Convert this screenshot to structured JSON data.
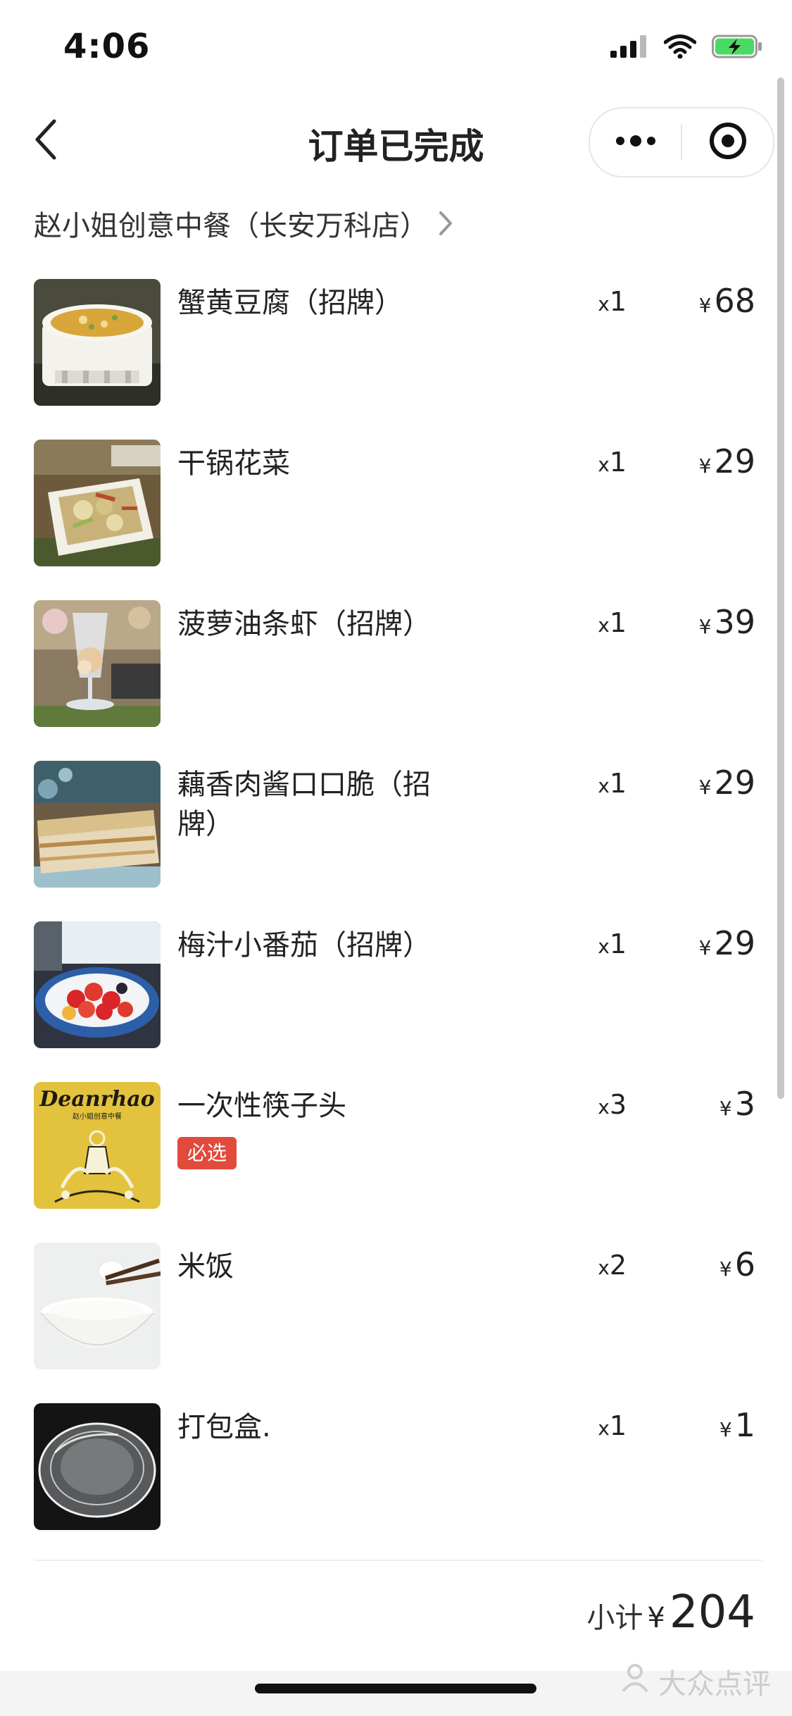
{
  "status_bar": {
    "time": "4:06",
    "icons": [
      "signal-icon",
      "wifi-icon",
      "battery-charging-icon"
    ],
    "battery_color": "#4cd964"
  },
  "header": {
    "title": "订单已完成",
    "back_icon": "chevron-left-icon",
    "capsule": [
      "more-icon",
      "close-target-icon"
    ]
  },
  "store": {
    "name": "赵小姐创意中餐（长安万科店）",
    "chevron": "chevron-right-icon"
  },
  "items": [
    {
      "name": "蟹黄豆腐（招牌）",
      "qty_prefix": "x",
      "qty": "1",
      "currency": "¥",
      "price": "68",
      "badge": ""
    },
    {
      "name": "干锅花菜",
      "qty_prefix": "x",
      "qty": "1",
      "currency": "¥",
      "price": "29",
      "badge": ""
    },
    {
      "name": "菠萝油条虾（招牌）",
      "qty_prefix": "x",
      "qty": "1",
      "currency": "¥",
      "price": "39",
      "badge": ""
    },
    {
      "name": "藕香肉酱口口脆（招牌）",
      "qty_prefix": "x",
      "qty": "1",
      "currency": "¥",
      "price": "29",
      "badge": ""
    },
    {
      "name": "梅汁小番茄（招牌）",
      "qty_prefix": "x",
      "qty": "1",
      "currency": "¥",
      "price": "29",
      "badge": ""
    },
    {
      "name": "一次性筷子头",
      "qty_prefix": "x",
      "qty": "3",
      "currency": "¥",
      "price": "3",
      "badge": "必选"
    },
    {
      "name": "米饭",
      "qty_prefix": "x",
      "qty": "2",
      "currency": "¥",
      "price": "6",
      "badge": ""
    },
    {
      "name": "打包盒.",
      "qty_prefix": "x",
      "qty": "1",
      "currency": "¥",
      "price": "1",
      "badge": ""
    }
  ],
  "chopsticks_logo": {
    "brand": "Deanrhao",
    "subtitle": "赵小姐创意中餐"
  },
  "subtotal": {
    "label": "小计",
    "currency": "¥",
    "value": "204"
  },
  "watermark": {
    "text": "大众点评"
  },
  "colors": {
    "badge": "#e24a3b",
    "text": "#222222"
  }
}
